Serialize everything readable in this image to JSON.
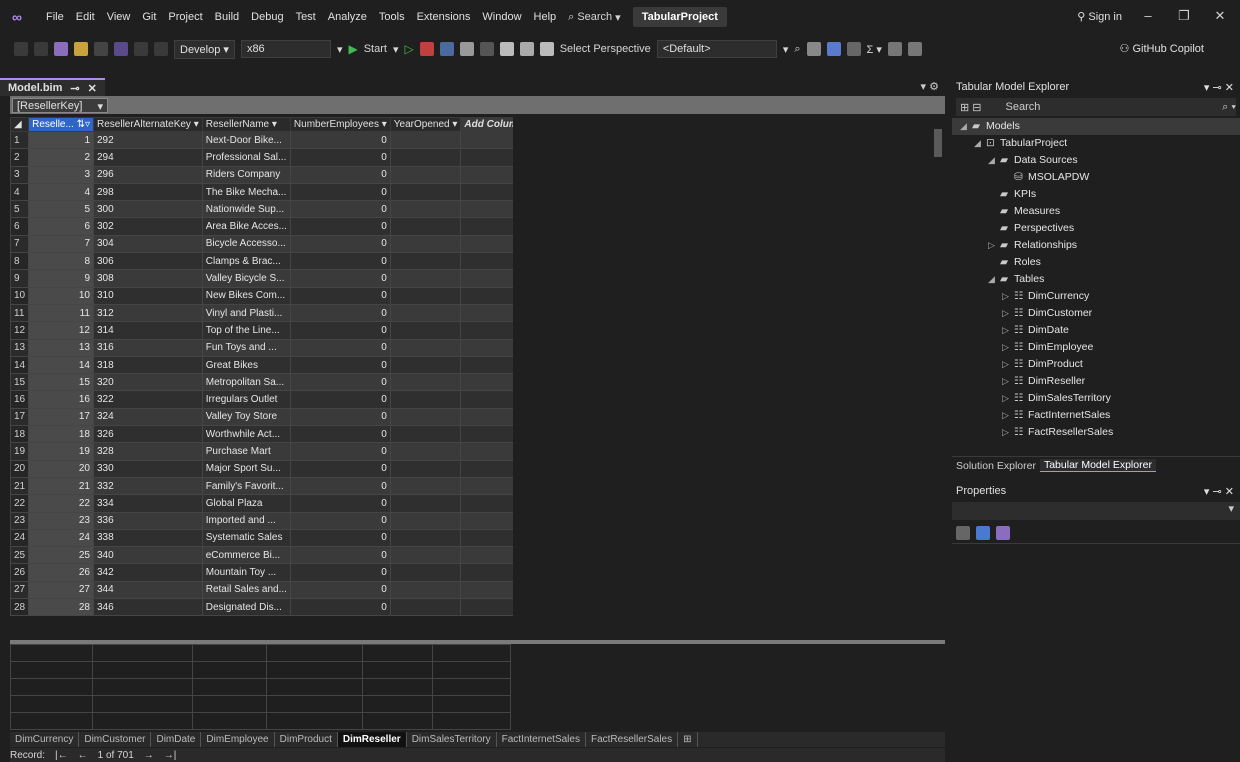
{
  "menubar": {
    "items": [
      "File",
      "Edit",
      "View",
      "Git",
      "Project",
      "Build",
      "Debug",
      "Test",
      "Analyze",
      "Tools",
      "Extensions",
      "Window",
      "Help"
    ],
    "search_label": "Search",
    "project_name": "TabularProject",
    "sign_in": "Sign in"
  },
  "toolbar": {
    "config": "Develop",
    "platform": "x86",
    "start_label": "Start",
    "perspective_label": "Select Perspective",
    "perspective_value": "<Default>",
    "copilot": "GitHub Copilot"
  },
  "document": {
    "tab_label": "Model.bim",
    "column_selector": "[ResellerKey]"
  },
  "grid": {
    "columns": [
      "Reselle...",
      "ResellerAlternateKey",
      "ResellerName",
      "NumberEmployees",
      "YearOpened",
      "Add Column"
    ],
    "rows": [
      [
        1,
        1,
        "292",
        "Next-Door Bike...",
        "0",
        ""
      ],
      [
        2,
        2,
        "294",
        "Professional Sal...",
        "0",
        ""
      ],
      [
        3,
        3,
        "296",
        "Riders Company",
        "0",
        ""
      ],
      [
        4,
        4,
        "298",
        "The Bike Mecha...",
        "0",
        ""
      ],
      [
        5,
        5,
        "300",
        "Nationwide Sup...",
        "0",
        ""
      ],
      [
        6,
        6,
        "302",
        "Area Bike Acces...",
        "0",
        ""
      ],
      [
        7,
        7,
        "304",
        "Bicycle Accesso...",
        "0",
        ""
      ],
      [
        8,
        8,
        "306",
        "Clamps & Brac...",
        "0",
        ""
      ],
      [
        9,
        9,
        "308",
        "Valley Bicycle S...",
        "0",
        ""
      ],
      [
        10,
        10,
        "310",
        "New Bikes Com...",
        "0",
        ""
      ],
      [
        11,
        11,
        "312",
        "Vinyl and Plasti...",
        "0",
        ""
      ],
      [
        12,
        12,
        "314",
        "Top of the Line...",
        "0",
        ""
      ],
      [
        13,
        13,
        "316",
        "Fun Toys and ...",
        "0",
        ""
      ],
      [
        14,
        14,
        "318",
        "Great Bikes",
        "0",
        ""
      ],
      [
        15,
        15,
        "320",
        "Metropolitan Sa...",
        "0",
        ""
      ],
      [
        16,
        16,
        "322",
        "Irregulars Outlet",
        "0",
        ""
      ],
      [
        17,
        17,
        "324",
        "Valley Toy Store",
        "0",
        ""
      ],
      [
        18,
        18,
        "326",
        "Worthwhile Act...",
        "0",
        ""
      ],
      [
        19,
        19,
        "328",
        "Purchase Mart",
        "0",
        ""
      ],
      [
        20,
        20,
        "330",
        "Major Sport Su...",
        "0",
        ""
      ],
      [
        21,
        21,
        "332",
        "Family's Favorit...",
        "0",
        ""
      ],
      [
        22,
        22,
        "334",
        "Global Plaza",
        "0",
        ""
      ],
      [
        23,
        23,
        "336",
        "Imported and ...",
        "0",
        ""
      ],
      [
        24,
        24,
        "338",
        "Systematic Sales",
        "0",
        ""
      ],
      [
        25,
        25,
        "340",
        "eCommerce Bi...",
        "0",
        ""
      ],
      [
        26,
        26,
        "342",
        "Mountain Toy ...",
        "0",
        ""
      ],
      [
        27,
        27,
        "344",
        "Retail Sales and...",
        "0",
        ""
      ],
      [
        28,
        28,
        "346",
        "Designated Dis...",
        "0",
        ""
      ]
    ]
  },
  "table_tabs": [
    "DimCurrency",
    "DimCustomer",
    "DimDate",
    "DimEmployee",
    "DimProduct",
    "DimReseller",
    "DimSalesTerritory",
    "FactInternetSales",
    "FactResellerSales"
  ],
  "active_table_tab": "DimReseller",
  "status": {
    "record_label": "Record:",
    "record_position": "1 of 701"
  },
  "explorer": {
    "title": "Tabular Model Explorer",
    "search_placeholder": "Search",
    "tree": [
      {
        "label": "Models",
        "level": 0,
        "arrow": "◢",
        "icon": "folder"
      },
      {
        "label": "TabularProject",
        "level": 1,
        "arrow": "◢",
        "icon": "model"
      },
      {
        "label": "Data Sources",
        "level": 2,
        "arrow": "◢",
        "icon": "folder"
      },
      {
        "label": "MSOLAPDW",
        "level": 3,
        "arrow": "",
        "icon": "db"
      },
      {
        "label": "KPIs",
        "level": 2,
        "arrow": "",
        "icon": "folder"
      },
      {
        "label": "Measures",
        "level": 2,
        "arrow": "",
        "icon": "folder"
      },
      {
        "label": "Perspectives",
        "level": 2,
        "arrow": "",
        "icon": "folder"
      },
      {
        "label": "Relationships",
        "level": 2,
        "arrow": "▷",
        "icon": "folder"
      },
      {
        "label": "Roles",
        "level": 2,
        "arrow": "",
        "icon": "folder"
      },
      {
        "label": "Tables",
        "level": 2,
        "arrow": "◢",
        "icon": "folder"
      },
      {
        "label": "DimCurrency",
        "level": 3,
        "arrow": "▷",
        "icon": "table"
      },
      {
        "label": "DimCustomer",
        "level": 3,
        "arrow": "▷",
        "icon": "table"
      },
      {
        "label": "DimDate",
        "level": 3,
        "arrow": "▷",
        "icon": "table"
      },
      {
        "label": "DimEmployee",
        "level": 3,
        "arrow": "▷",
        "icon": "table"
      },
      {
        "label": "DimProduct",
        "level": 3,
        "arrow": "▷",
        "icon": "table"
      },
      {
        "label": "DimReseller",
        "level": 3,
        "arrow": "▷",
        "icon": "table"
      },
      {
        "label": "DimSalesTerritory",
        "level": 3,
        "arrow": "▷",
        "icon": "table"
      },
      {
        "label": "FactInternetSales",
        "level": 3,
        "arrow": "▷",
        "icon": "table"
      },
      {
        "label": "FactResellerSales",
        "level": 3,
        "arrow": "▷",
        "icon": "table"
      }
    ],
    "bottom_tabs": [
      "Solution Explorer",
      "Tabular Model Explorer"
    ]
  },
  "properties": {
    "title": "Properties"
  }
}
